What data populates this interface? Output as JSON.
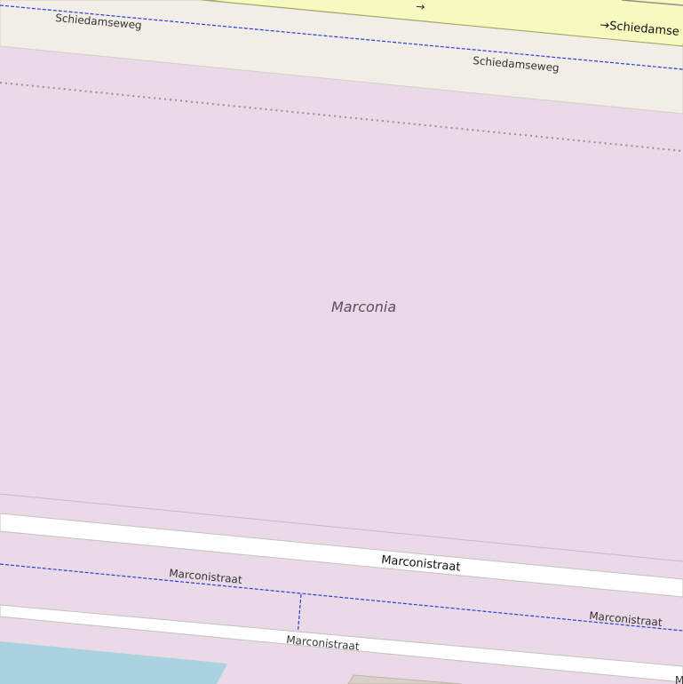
{
  "map": {
    "area_name": "Marconia",
    "labels": {
      "schiedamseweg_left": "Schiedamseweg",
      "schiedamseweg_right": "Schiedamseweg",
      "schiedamseweg_major": "→Schiedamse",
      "oneway_arrow": "→",
      "marconistraat_main": "Marconistraat",
      "marconistraat_path_left": "Marconistraat",
      "marconistraat_path_right": "Marconistraat",
      "marconistraat_lower": "Marconistraat",
      "edge_fragment": "M"
    },
    "colors": {
      "landuse": "#eadae8",
      "road_band": "#f1eee8",
      "major_road": "#f7fabf",
      "minor_road": "#ffffff",
      "footway": "#2d3fd6",
      "water": "#aad3df",
      "building": "#d9d0c9"
    }
  }
}
